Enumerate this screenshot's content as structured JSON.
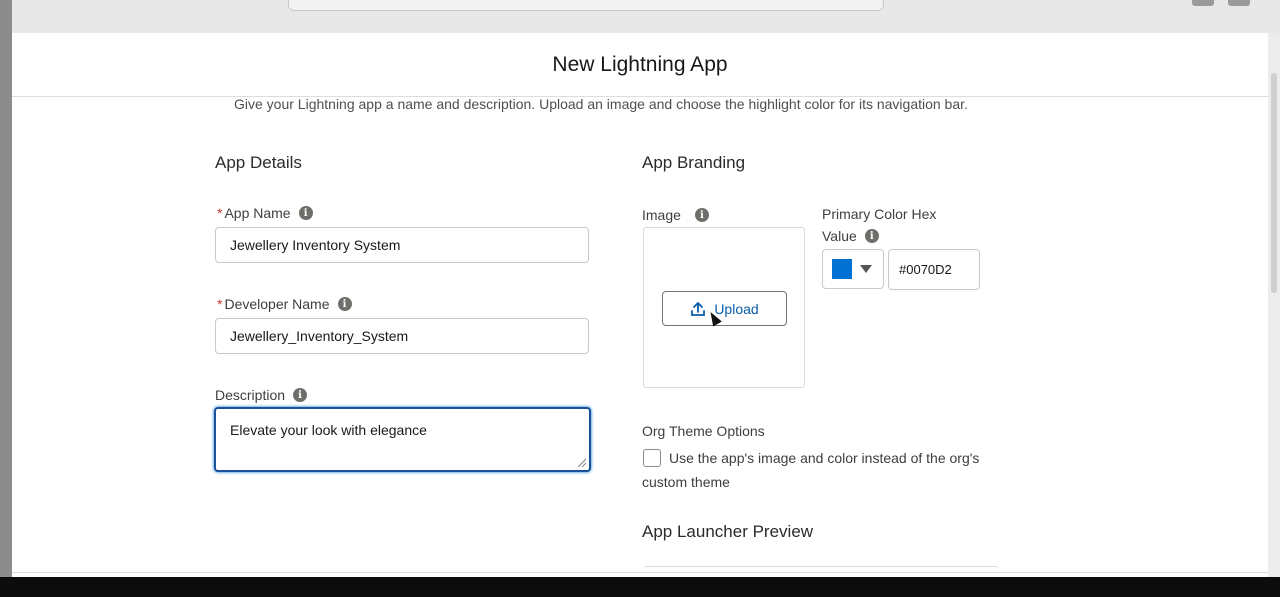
{
  "modal": {
    "title": "New Lightning App",
    "subtitle": "Give your Lightning app a name and description. Upload an image and choose the highlight color for its navigation bar."
  },
  "app_details": {
    "section_title": "App Details",
    "app_name_label": "App Name",
    "app_name_value": "Jewellery Inventory System",
    "developer_name_label": "Developer Name",
    "developer_name_value": "Jewellery_Inventory_System",
    "description_label": "Description",
    "description_value": "Elevate your look with elegance",
    "required_marker": "*"
  },
  "app_branding": {
    "section_title": "App Branding",
    "image_label": "Image",
    "upload_label": "Upload",
    "primary_color_label_line1": "Primary Color Hex",
    "primary_color_label_line2": "Value",
    "primary_color_value": "#0070D2",
    "swatch_color": "#0070d2",
    "org_theme_label": "Org Theme Options",
    "org_theme_checkbox_line1": "Use the app's image and color instead of the org's",
    "org_theme_checkbox_line2": "custom theme",
    "org_theme_checked": false,
    "launcher_preview_title": "App Launcher Preview"
  },
  "icons": {
    "info": "info-icon",
    "upload": "upload-icon",
    "caret": "chevron-down-icon"
  },
  "colors": {
    "focus_border": "#1b5297",
    "link_text": "#0b5cab",
    "required": "#c23934"
  }
}
